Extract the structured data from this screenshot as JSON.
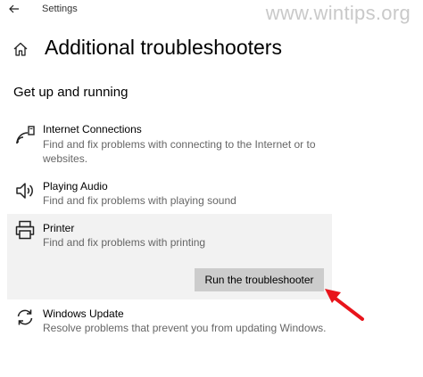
{
  "window": {
    "title": "Settings"
  },
  "watermark": "www.wintips.org",
  "page": {
    "title": "Additional troubleshooters"
  },
  "section": {
    "heading": "Get up and running"
  },
  "items": [
    {
      "icon": "network-icon",
      "label": "Internet Connections",
      "description": "Find and fix problems with connecting to the Internet or to websites."
    },
    {
      "icon": "speaker-icon",
      "label": "Playing Audio",
      "description": "Find and fix problems with playing sound"
    },
    {
      "icon": "printer-icon",
      "label": "Printer",
      "description": "Find and fix problems with printing",
      "selected": true
    },
    {
      "icon": "refresh-icon",
      "label": "Windows Update",
      "description": "Resolve problems that prevent you from updating Windows."
    }
  ],
  "run_button": {
    "label": "Run the troubleshooter"
  },
  "colors": {
    "selected_bg": "#f2f2f2",
    "button_bg": "#cccccc",
    "annotation_arrow": "#e8141b",
    "description_text": "#666666"
  }
}
